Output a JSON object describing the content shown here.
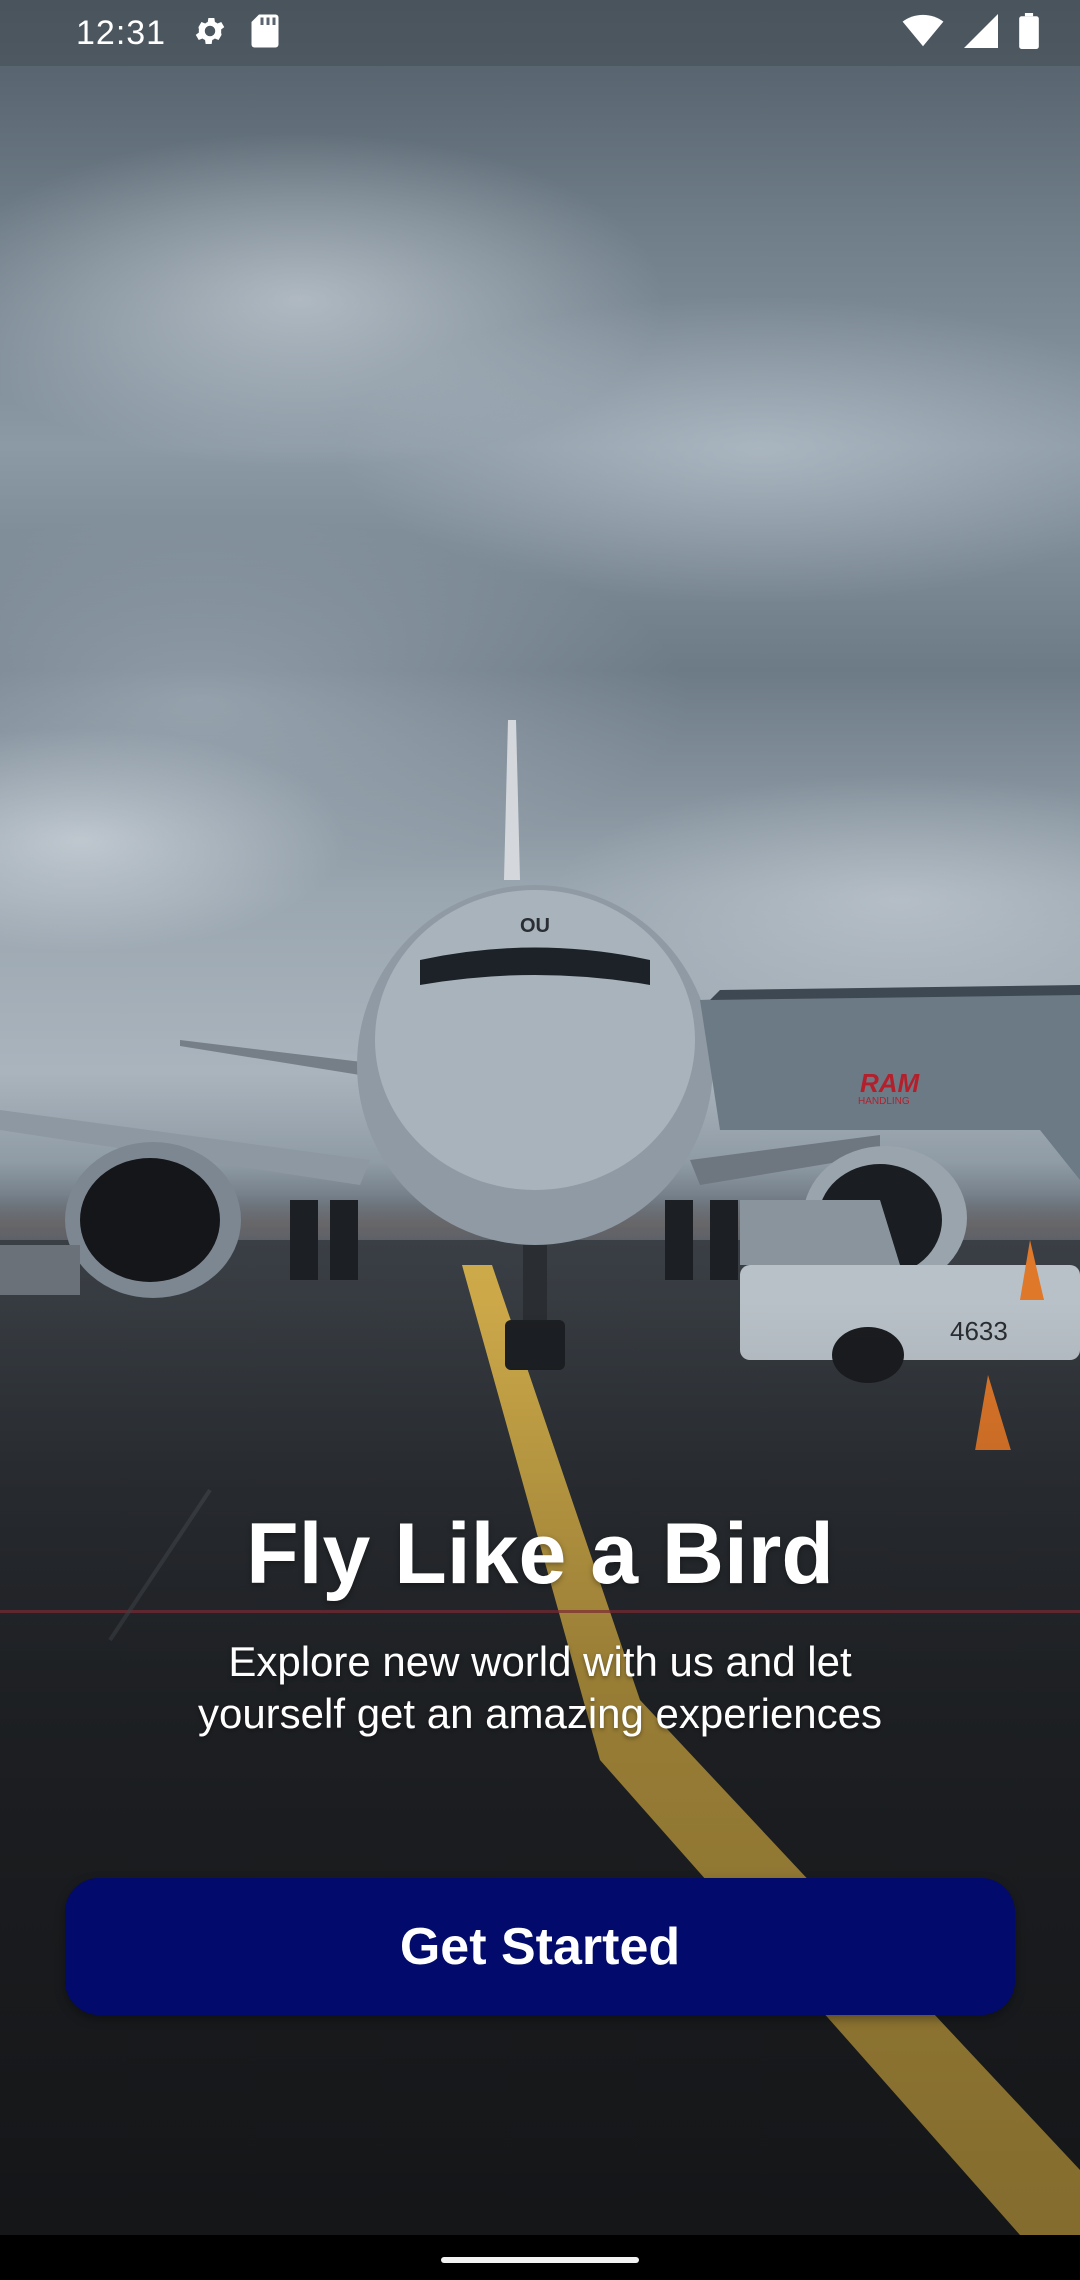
{
  "status_bar": {
    "time": "12:31",
    "left_icons": [
      "settings-icon",
      "sd-card-icon"
    ],
    "right_icons": [
      "wifi-icon",
      "signal-icon",
      "battery-icon"
    ]
  },
  "hero": {
    "title": "Fly Like a Bird",
    "subtitle_line1": "Explore new world with us and let",
    "subtitle_line2": "yourself get an amazing experiences"
  },
  "actions": {
    "get_started_label": "Get Started"
  },
  "photo": {
    "nose_marking": "OU",
    "stairs_logo": "RAM",
    "stairs_logo_sub": "HANDLING",
    "ground_vehicle_number": "4633"
  },
  "colors": {
    "button_background": "#020a6b",
    "text": "#ffffff",
    "taxi_line": "#d9b24a",
    "nav_bar": "#000000"
  }
}
